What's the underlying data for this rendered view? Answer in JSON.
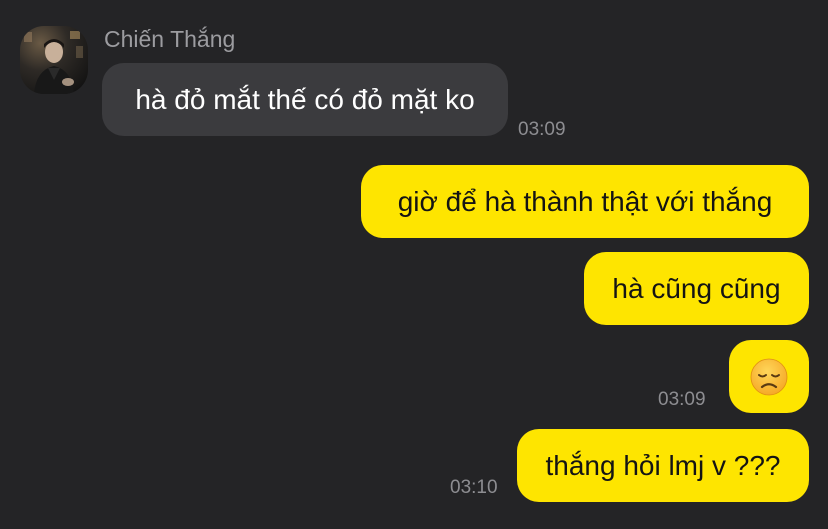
{
  "chat": {
    "sender": {
      "name": "Chiến Thắng",
      "avatar": "profile-photo"
    },
    "messages": [
      {
        "direction": "incoming",
        "text": "hà đỏ mắt thế có đỏ mặt ko",
        "time": "03:09"
      },
      {
        "direction": "outgoing",
        "text": "giờ để hà thành thật với thắng"
      },
      {
        "direction": "outgoing",
        "text": "hà cũng cũng"
      },
      {
        "direction": "outgoing",
        "emoji": "disappointed-face-emoji",
        "time": "03:09"
      },
      {
        "direction": "outgoing",
        "text": "thắng hỏi lmj v ???",
        "time": "03:10"
      }
    ]
  },
  "colors": {
    "background": "#242426",
    "incoming_bubble": "#3b3b3e",
    "outgoing_bubble": "#fee500",
    "timestamp": "#8d8d91"
  }
}
